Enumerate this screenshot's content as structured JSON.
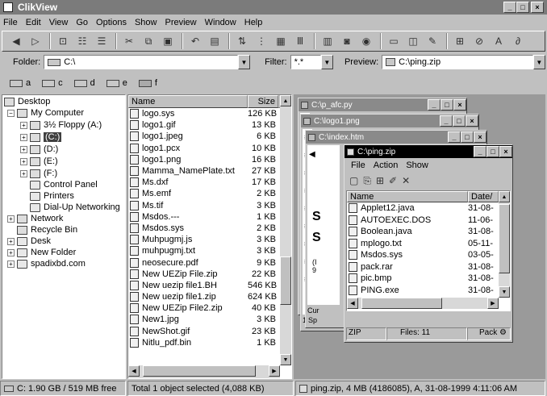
{
  "app": {
    "title": "ClikView"
  },
  "menu": [
    "File",
    "Edit",
    "View",
    "Go",
    "Options",
    "Show",
    "Preview",
    "Window",
    "Help"
  ],
  "toolbar_icons": [
    "back-icon",
    "forward-icon",
    "up-folder-icon",
    "tree-icon",
    "list-icon",
    "cut-icon",
    "copy-icon",
    "paste-icon",
    "undo-icon",
    "properties-icon",
    "sort-icon",
    "details-icon",
    "columns-icon",
    "large-icons-icon",
    "small-icons-icon",
    "web-icon",
    "view-icon",
    "image-icon",
    "find-icon",
    "edit-icon",
    "text-icon",
    "zip-icon"
  ],
  "address": {
    "folder_label": "Folder:",
    "folder_value": "C:\\",
    "filter_label": "Filter:",
    "filter_value": "*.*",
    "preview_label": "Preview:",
    "preview_value": "C:\\ping.zip"
  },
  "drives": [
    "a",
    "c",
    "d",
    "e",
    "f"
  ],
  "tree": {
    "desktop": "Desktop",
    "my_computer": "My Computer",
    "floppy": "3½ Floppy (A:)",
    "c": "(C:)",
    "d": "(D:)",
    "e": "(E:)",
    "f": "(F:)",
    "control_panel": "Control Panel",
    "printers": "Printers",
    "dialup": "Dial-Up Networking",
    "network": "Network",
    "recycle": "Recycle Bin",
    "desk": "Desk",
    "new_folder": "New Folder",
    "spadix": "spadixbd.com"
  },
  "file_list": {
    "col_name": "Name",
    "col_size": "Size",
    "rows": [
      {
        "name": "logo.sys",
        "size": "126 KB"
      },
      {
        "name": "logo1.gif",
        "size": "13 KB"
      },
      {
        "name": "logo1.jpeg",
        "size": "6 KB"
      },
      {
        "name": "logo1.pcx",
        "size": "10 KB"
      },
      {
        "name": "logo1.png",
        "size": "16 KB"
      },
      {
        "name": "Mamma_NamePlate.txt",
        "size": "27 KB"
      },
      {
        "name": "Ms.dxf",
        "size": "17 KB"
      },
      {
        "name": "Ms.emf",
        "size": "2 KB"
      },
      {
        "name": "Ms.tif",
        "size": "3 KB"
      },
      {
        "name": "Msdos.---",
        "size": "1 KB"
      },
      {
        "name": "Msdos.sys",
        "size": "2 KB"
      },
      {
        "name": "Muhpugmj.js",
        "size": "3 KB"
      },
      {
        "name": "muhpugmj.txt",
        "size": "3 KB"
      },
      {
        "name": "neosecure.pdf",
        "size": "9 KB"
      },
      {
        "name": "New UEZip File.zip",
        "size": "22 KB"
      },
      {
        "name": "New uezip file1.BH",
        "size": "546 KB"
      },
      {
        "name": "New uezip file1.zip",
        "size": "624 KB"
      },
      {
        "name": "New UEZip File2.zip",
        "size": "40 KB"
      },
      {
        "name": "New1.jpg",
        "size": "3 KB"
      },
      {
        "name": "NewShot.gif",
        "size": "23 KB"
      },
      {
        "name": "Nitlu_pdf.bin",
        "size": "1 KB"
      }
    ]
  },
  "preview_windows": {
    "w1": "C:\\p_afc.py",
    "w2": "C:\\logo1.png",
    "w3": "C:\\index.htm",
    "w4": "C:\\ping.zip"
  },
  "zip_window": {
    "menu": [
      "File",
      "Action",
      "Show"
    ],
    "col_name": "Name",
    "col_date": "Date/",
    "rows": [
      {
        "name": "Applet12.java",
        "date": "31-08-"
      },
      {
        "name": "AUTOEXEC.DOS",
        "date": "11-06-"
      },
      {
        "name": "Boolean.java",
        "date": "31-08-"
      },
      {
        "name": "mplogo.txt",
        "date": "05-11-"
      },
      {
        "name": "Msdos.sys",
        "date": "03-05-"
      },
      {
        "name": "pack.rar",
        "date": "31-08-"
      },
      {
        "name": "pic.bmp",
        "date": "31-08-"
      },
      {
        "name": "PING.exe",
        "date": "31-08-"
      }
    ],
    "status_type": "ZIP",
    "status_files": "Files: 11",
    "status_pack": "Pack"
  },
  "status": {
    "drive": "C: 1.90 GB / 519 MB free",
    "selection": "Total 1 object selected (4,088 KB)",
    "preview": "ping.zip, 4 MB (4186085), A, 31-08-1999 4:11:06 AM"
  }
}
